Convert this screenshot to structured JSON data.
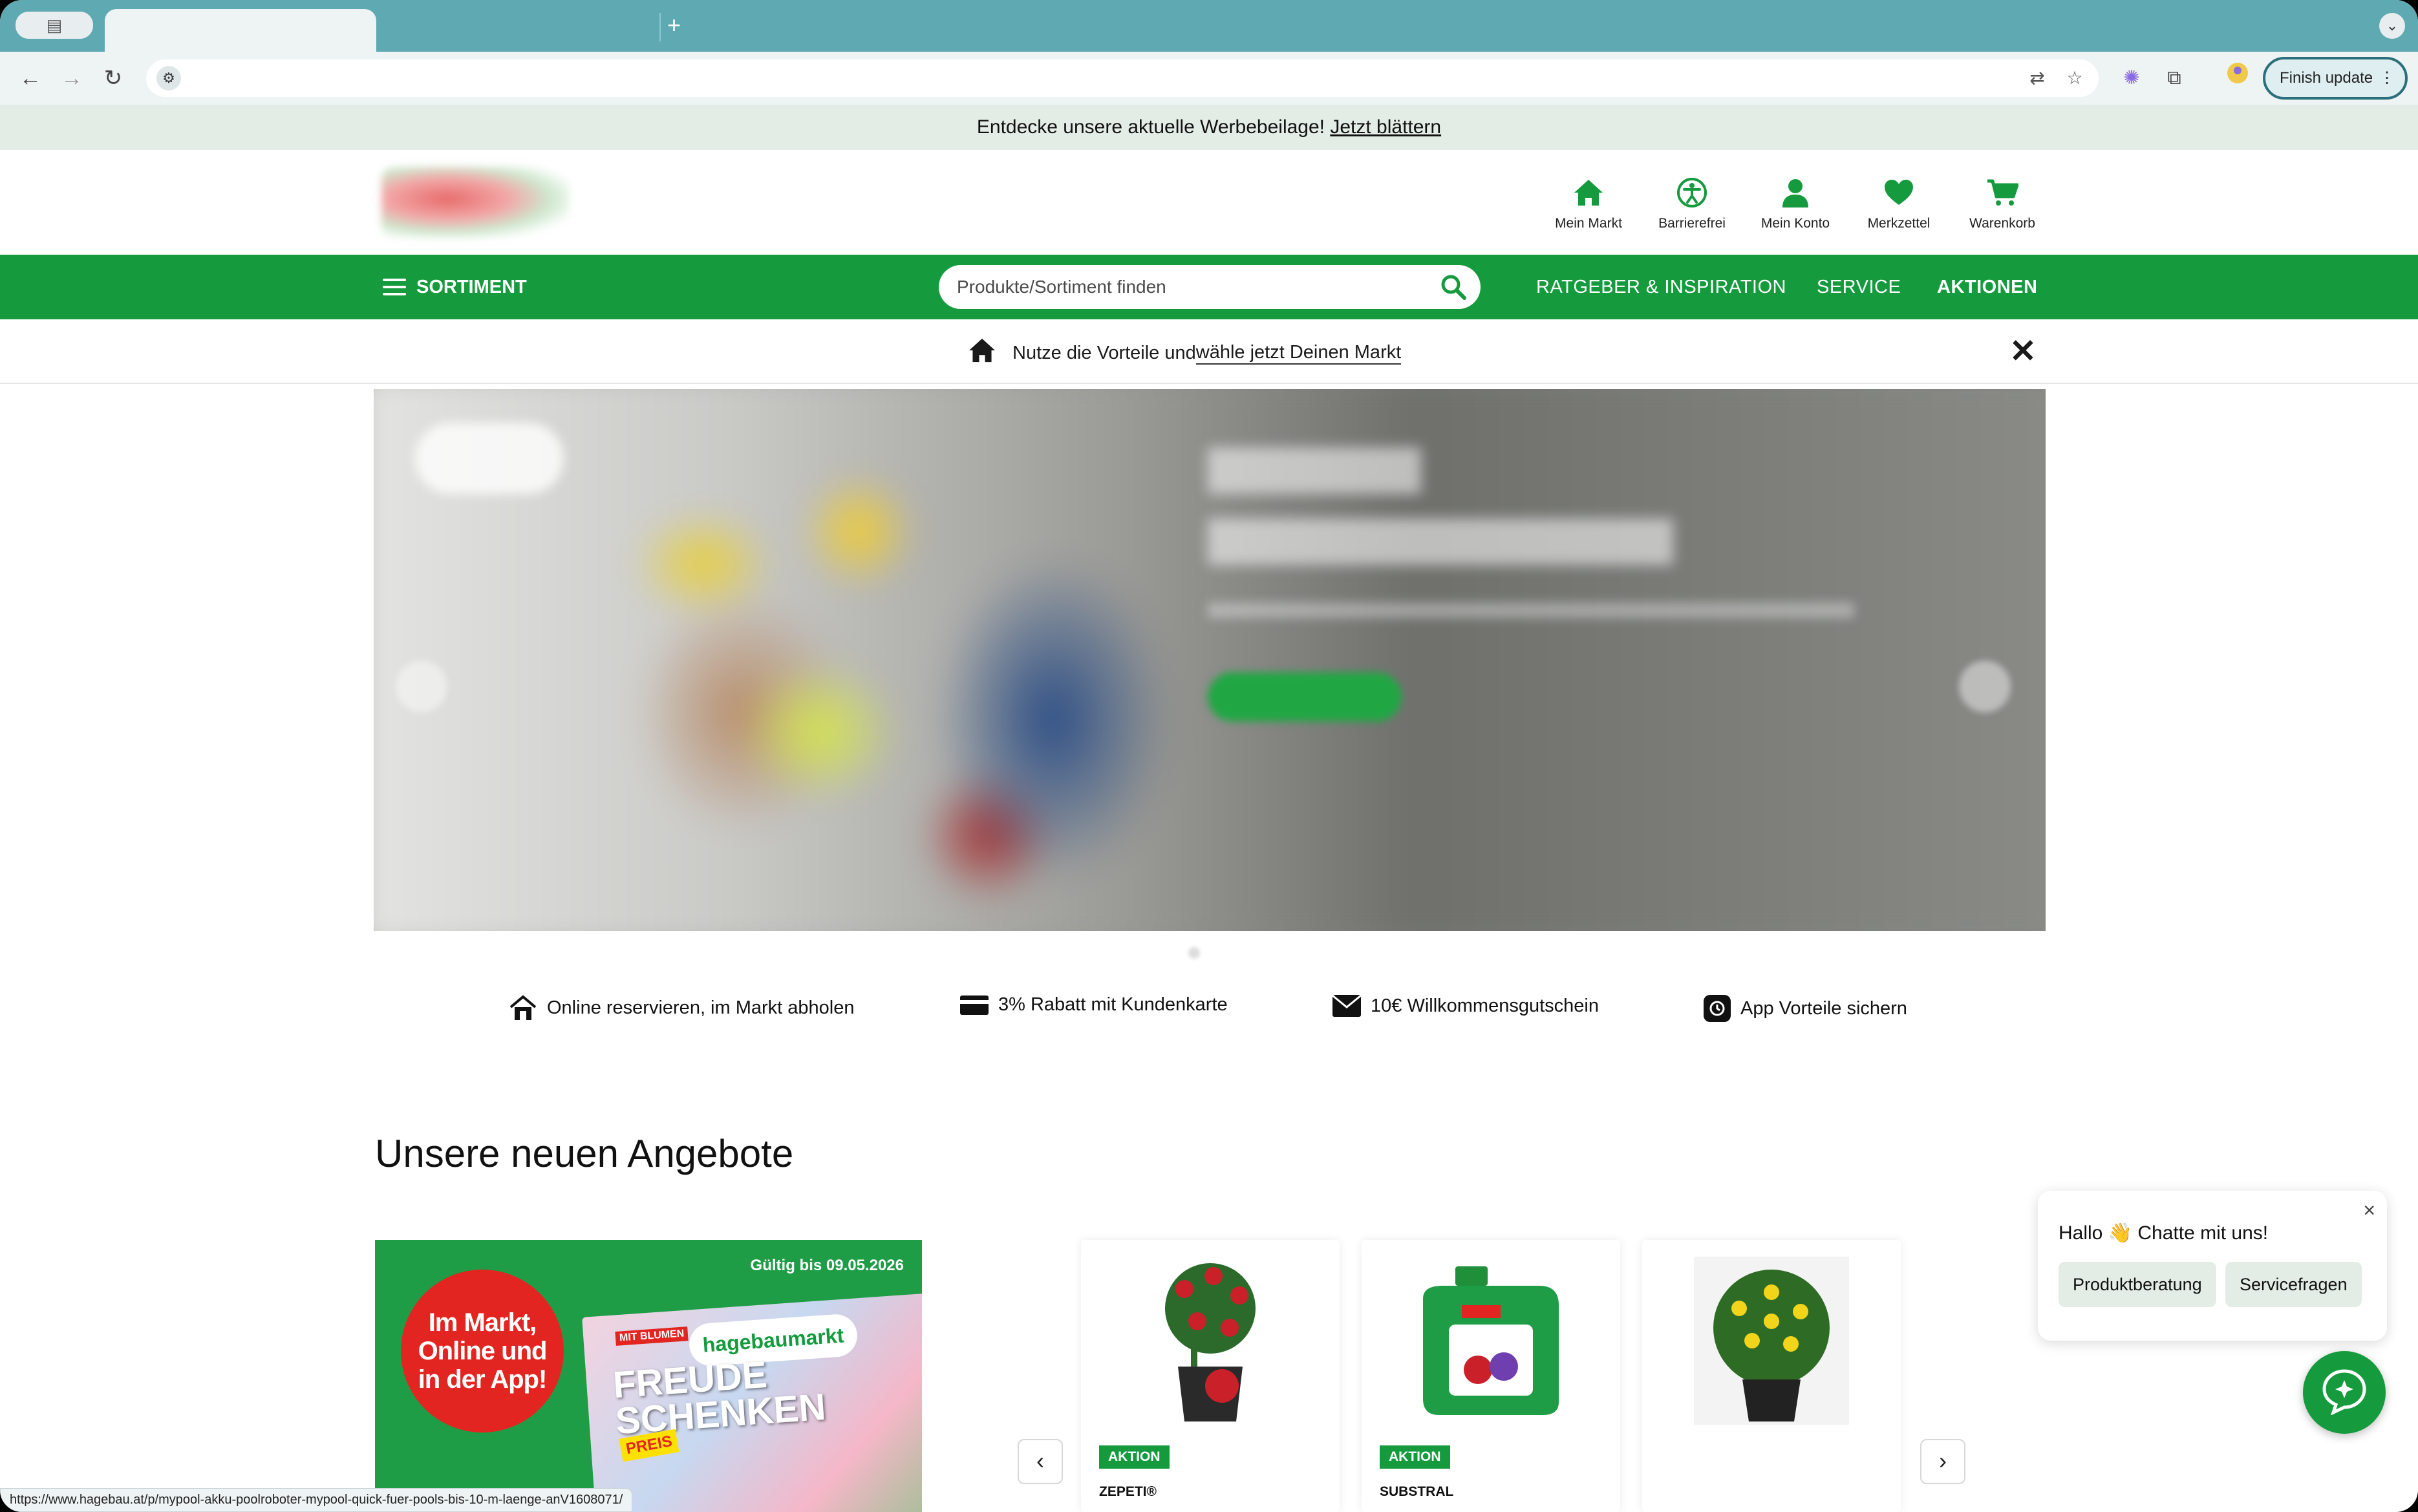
{
  "browser": {
    "new_tab": "+",
    "finish_update": "Finish update",
    "status_url": "https://www.hagebau.at/p/mypool-akku-poolroboter-mypool-quick-fuer-pools-bis-10-m-laenge-anV1608071/"
  },
  "promo": {
    "text": "Entdecke unsere aktuelle Werbebeilage!",
    "link": "Jetzt blättern"
  },
  "header": {
    "icons": [
      {
        "label": "Mein Markt",
        "icon": "home-icon"
      },
      {
        "label": "Barrierefrei",
        "icon": "accessibility-icon"
      },
      {
        "label": "Mein Konto",
        "icon": "user-icon"
      },
      {
        "label": "Merkzettel",
        "icon": "heart-icon"
      },
      {
        "label": "Warenkorb",
        "icon": "cart-icon"
      }
    ]
  },
  "nav": {
    "sortiment": "SORTIMENT",
    "search_placeholder": "Produkte/Sortiment finden",
    "links": [
      "RATGEBER & INSPIRATION",
      "SERVICE",
      "AKTIONEN"
    ]
  },
  "market_bar": {
    "text_prefix": "Nutze die Vorteile und ",
    "text_link": "wähle jetzt Deinen Markt"
  },
  "benefits": [
    {
      "text": "Online reservieren, im Markt abholen",
      "icon": "pickup-icon"
    },
    {
      "text": "3% Rabatt mit Kundenkarte",
      "icon": "card-icon"
    },
    {
      "text": "10€ Willkommensgutschein",
      "icon": "voucher-icon"
    },
    {
      "text": "App Vorteile sichern",
      "icon": "app-icon"
    }
  ],
  "offers": {
    "title": "Unsere neuen Angebote",
    "flyer": {
      "valid": "Gültig bis 09.05.2026",
      "circle_lines": [
        "Im Markt,",
        "Online und",
        "in der App!"
      ],
      "brand": "hagebaumarkt",
      "tagline": "MIT BLUMEN",
      "headline_1": "FREUDE",
      "headline_2": "SCHENKEN",
      "price_tag": "PREIS"
    },
    "products": [
      {
        "badge": "AKTION",
        "brand": "ZEPETI®"
      },
      {
        "badge": "AKTION",
        "brand": "SUBSTRAL"
      },
      {
        "badge": "",
        "brand": ""
      }
    ]
  },
  "chat": {
    "greeting": "Hallo 👋 Chatte mit uns!",
    "chips": [
      "Produktberatung",
      "Servicefragen"
    ],
    "close": "×"
  },
  "colors": {
    "brand_green": "#159b3d",
    "promo_bg": "#e4ede5",
    "accent_red": "#e32521"
  }
}
